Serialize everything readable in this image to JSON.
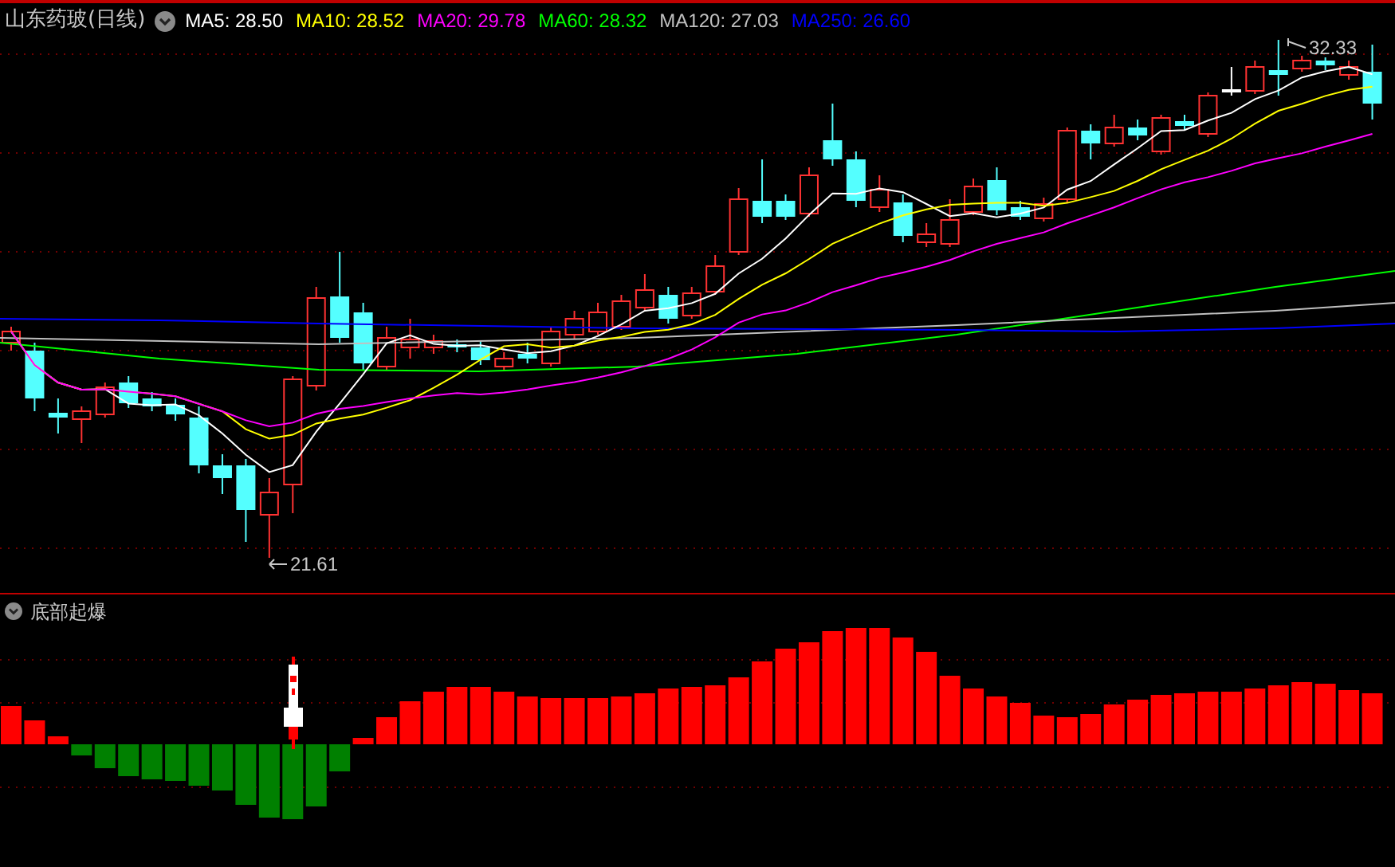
{
  "main_chart": {
    "title": "山东药玻(日线)",
    "moving_averages": [
      {
        "label": "MA5: 28.50",
        "color": "#ffffff"
      },
      {
        "label": "MA10: 28.52",
        "color": "#ffff00"
      },
      {
        "label": "MA20: 29.78",
        "color": "#ff00ff"
      },
      {
        "label": "MA60: 28.32",
        "color": "#00ff00"
      },
      {
        "label": "MA120: 27.03",
        "color": "#c0c0c0"
      },
      {
        "label": "MA250: 26.60",
        "color": "#0000ff"
      }
    ],
    "high_label": "32.33",
    "low_label": "21.61"
  },
  "indicator_panel": {
    "title": "底部起爆"
  }
}
